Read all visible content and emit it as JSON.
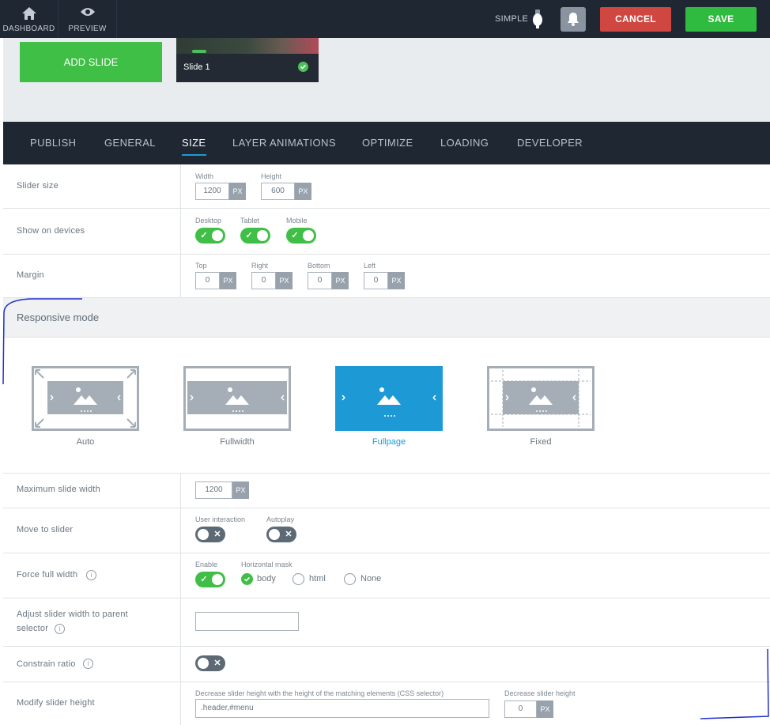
{
  "topbar": {
    "dashboard_label": "DASHBOARD",
    "preview_label": "PREVIEW",
    "simple_label": "SIMPLE",
    "cancel_label": "CANCEL",
    "save_label": "SAVE"
  },
  "slides": {
    "add_label": "ADD SLIDE",
    "items": [
      {
        "name": "Slide 1"
      }
    ]
  },
  "tabs": [
    {
      "label": "PUBLISH"
    },
    {
      "label": "GENERAL"
    },
    {
      "label": "SIZE",
      "active": true
    },
    {
      "label": "LAYER ANIMATIONS"
    },
    {
      "label": "OPTIMIZE"
    },
    {
      "label": "LOADING"
    },
    {
      "label": "DEVELOPER"
    }
  ],
  "slider_size": {
    "label": "Slider size",
    "width_label": "Width",
    "width_value": "1200",
    "height_label": "Height",
    "height_value": "600",
    "unit": "PX"
  },
  "devices": {
    "label": "Show on devices",
    "desktop": "Desktop",
    "tablet": "Tablet",
    "mobile": "Mobile"
  },
  "margin": {
    "label": "Margin",
    "top": "Top",
    "right": "Right",
    "bottom": "Bottom",
    "left": "Left",
    "top_value": "0",
    "right_value": "0",
    "bottom_value": "0",
    "left_value": "0",
    "unit": "PX"
  },
  "responsive": {
    "title": "Responsive mode",
    "modes": [
      {
        "label": "Auto"
      },
      {
        "label": "Fullwidth"
      },
      {
        "label": "Fullpage",
        "selected": true
      },
      {
        "label": "Fixed"
      }
    ]
  },
  "max_width": {
    "label": "Maximum slide width",
    "value": "1200",
    "unit": "PX"
  },
  "move_to_slider": {
    "label": "Move to slider",
    "user_interaction": "User interaction",
    "autoplay": "Autoplay"
  },
  "force_full_width": {
    "label": "Force full width",
    "enable": "Enable",
    "mask_label": "Horizontal mask",
    "options": [
      "body",
      "html",
      "None"
    ],
    "selected": "body"
  },
  "adjust_width": {
    "label_line1": "Adjust slider width to parent",
    "label_line2": "selector",
    "value": ""
  },
  "constrain_ratio": {
    "label": "Constrain ratio"
  },
  "modify_height": {
    "label": "Modify slider height",
    "selector_label": "Decrease slider height with the height of the matching elements (CSS selector)",
    "selector_value": ".header,#menu",
    "decrease_label": "Decrease slider height",
    "decrease_value": "0",
    "unit": "PX"
  },
  "colors": {
    "accent": "#1d9ad6",
    "green": "#3fbf45",
    "cancel": "#d04640",
    "dark": "#1e2732"
  }
}
